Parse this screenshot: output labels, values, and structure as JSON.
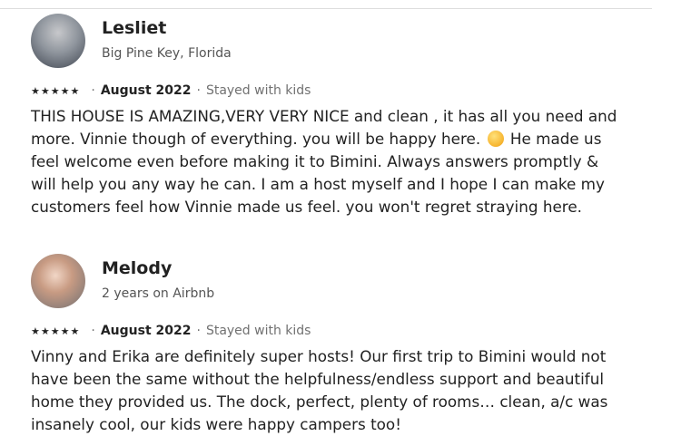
{
  "reviews": [
    {
      "name": "Lesliet",
      "subtitle": "Big Pine Key, Florida",
      "rating": 5,
      "date": "August 2022",
      "stay": "Stayed with kids",
      "text_before_emoji": "THIS HOUSE IS AMAZING,VERY VERY NICE and clean , it has all you need and more. Vinnie though of everything. you will be happy here. ",
      "text_after_emoji": " He made us feel welcome even before making it to Bimini. Always answers promptly & will help you any way he can. I am a host myself and I hope I can make my customers feel how Vinnie made us feel. you won't regret straying here."
    },
    {
      "name": "Melody",
      "subtitle": "2 years on Airbnb",
      "rating": 5,
      "date": "August 2022",
      "stay": "Stayed with kids",
      "text": "Vinny and Erika are definitely super hosts! Our first trip to Bimini would not have been the same without the helpfulness/endless support and beautiful home they provided us. The dock, perfect, plenty of rooms… clean, a/c was insanely cool, our kids were happy campers too!"
    }
  ],
  "ui": {
    "dot_separator": "·",
    "star_glyph": "★",
    "emoji_name": "smiling-face-emoji"
  }
}
